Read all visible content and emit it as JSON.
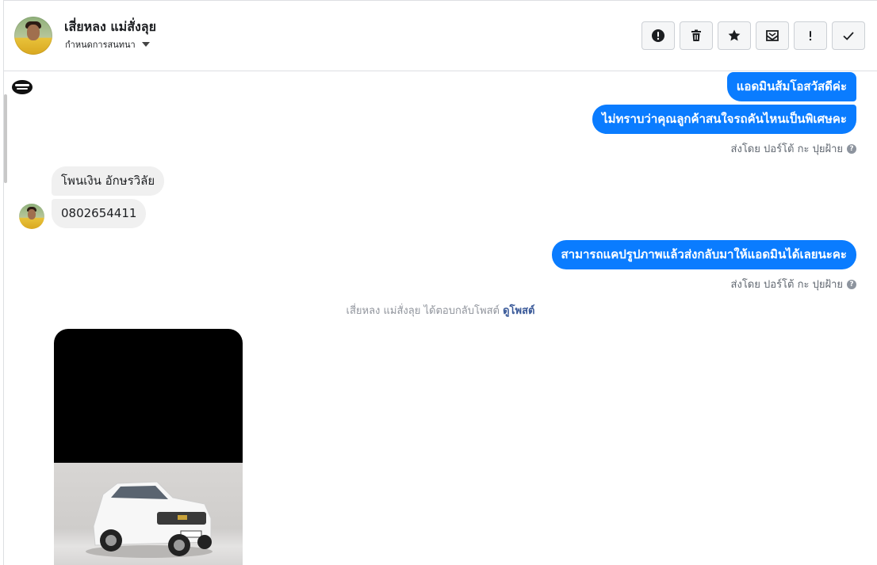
{
  "header": {
    "contact_name": "เสี่ยหลง แม่สั่งลุย",
    "assign_label": "กำหนดการสนทนา",
    "toolbar": [
      {
        "name": "report-spam-button",
        "icon": "alert-circle-icon"
      },
      {
        "name": "delete-button",
        "icon": "trash-icon"
      },
      {
        "name": "star-button",
        "icon": "star-icon"
      },
      {
        "name": "mark-unread-button",
        "icon": "envelope-icon"
      },
      {
        "name": "mark-important-button",
        "icon": "exclamation-icon"
      },
      {
        "name": "mark-done-button",
        "icon": "check-icon"
      }
    ]
  },
  "messages": {
    "out1": "แอดมินส้มโอสวัสดีค่ะ",
    "out2": "ไม่ทราบว่าคุณลูกค้าสนใจรถคันไหนเป็นพิเศษคะ",
    "sent_by_1": "ส่งโดย ปอร์โต้ กะ ปุยฝ้าย",
    "in1": "โพนเงิน อักษรวิลัย",
    "in2": "0802654411",
    "out3": "สามารถแคปรูปภาพแล้วส่งกลับมาให้แอดมินได้เลยนะคะ",
    "sent_by_2": "ส่งโดย ปอร์โต้ กะ ปุยฝ้าย",
    "reply_note_text": "เสี่ยหลง แม่สั่งลุย ได้ตอบกลับโพสต์",
    "reply_note_link": "ดูโพสต์",
    "help_glyph": "?"
  },
  "colors": {
    "outgoing_bubble": "#0a7cff",
    "incoming_bubble": "#f0f0f0",
    "link": "#385898"
  }
}
